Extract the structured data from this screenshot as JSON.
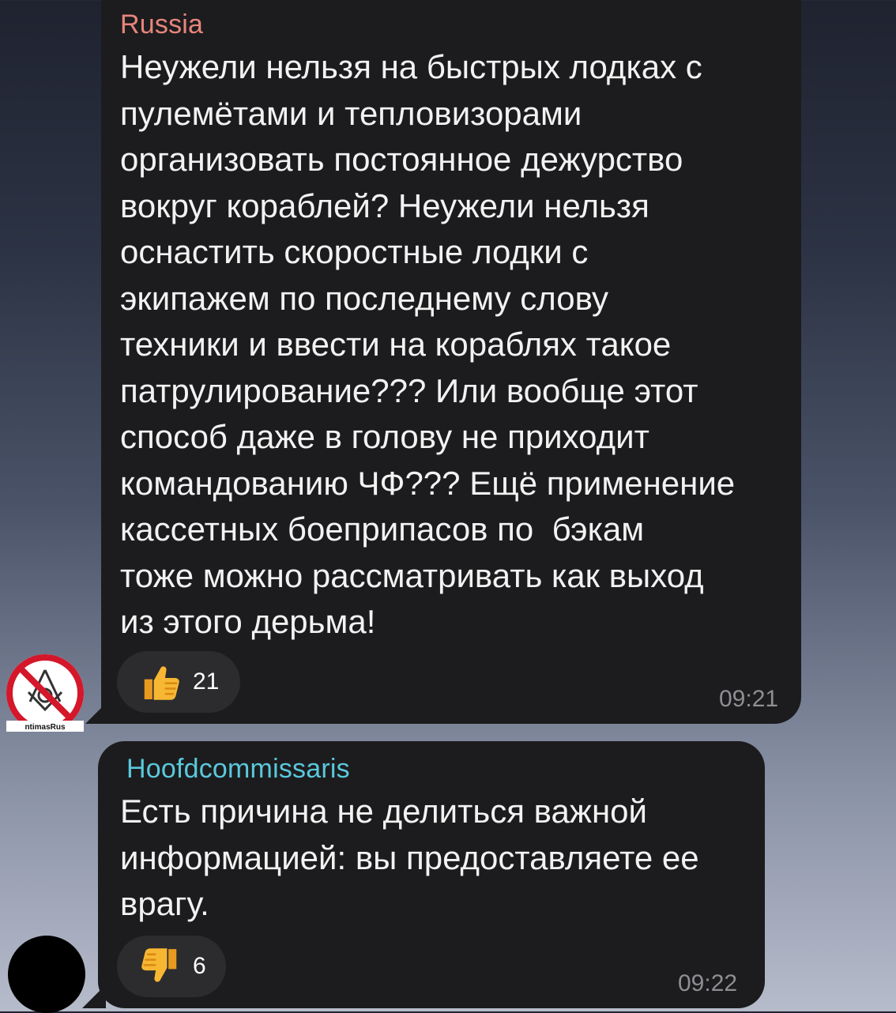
{
  "messages": [
    {
      "sender": "Russia",
      "sender_color": "#e8857b",
      "text": "Неужели нельзя на быстрых лодках с\nпулемётами и тепловизорами\nорганизовать постоянное дежурство\nвокруг кораблей? Неужели нельзя\nоснастить скоростные лодки с\nэкипажем по последнему слову\nтехники и ввести на кораблях такое\nпатрулирование??? Или вообще этот\nспособ даже в голову не приходит\nкомандованию ЧФ??? Ещё применение\nкассетных боеприпасов по  бэкам\nтоже можно рассматривать как выход\nиз этого дерьма!",
      "reaction_icon": "thumbs-up-icon",
      "reaction_count": "21",
      "time": "09:21",
      "avatar_label": "ntimasRus"
    },
    {
      "sender": "Hoofdcommissaris",
      "sender_color": "#5ac8dc",
      "text": "Есть причина не делиться важной\nинформацией: вы предоставляете ее\nврагу.",
      "reaction_icon": "thumbs-down-icon",
      "reaction_count": "6",
      "time": "09:22"
    }
  ]
}
